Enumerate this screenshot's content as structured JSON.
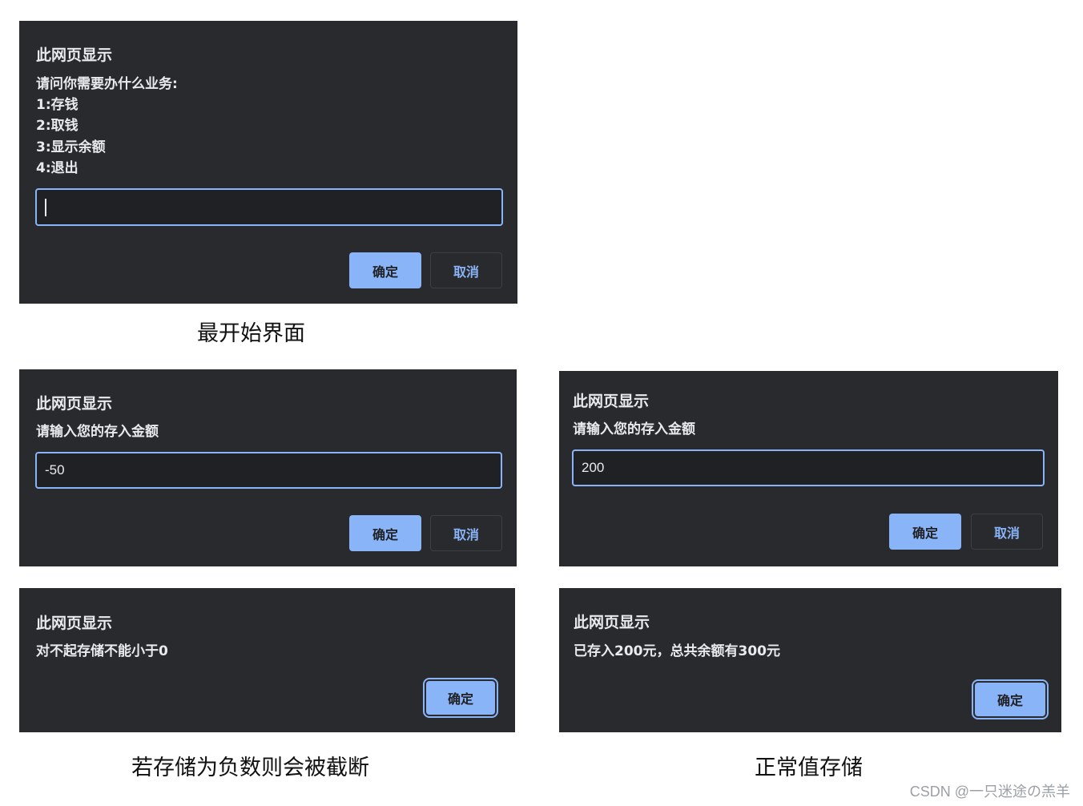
{
  "dialogs": {
    "menu": {
      "title": "此网页显示",
      "message": [
        "请问你需要办什么业务:",
        "1:存钱",
        "2:取钱",
        "3:显示余额",
        "4:退出"
      ],
      "input_value": "",
      "ok_label": "确定",
      "cancel_label": "取消"
    },
    "deposit_negative": {
      "title": "此网页显示",
      "message": "请输入您的存入金额",
      "input_value": "-50",
      "ok_label": "确定",
      "cancel_label": "取消"
    },
    "deposit_normal": {
      "title": "此网页显示",
      "message": "请输入您的存入金额",
      "input_value": "200",
      "ok_label": "确定",
      "cancel_label": "取消"
    },
    "alert_negative": {
      "title": "此网页显示",
      "message": "对不起存储不能小于0",
      "ok_label": "确定"
    },
    "alert_normal": {
      "title": "此网页显示",
      "message": "已存入200元，总共余额有300元",
      "ok_label": "确定"
    }
  },
  "captions": {
    "initial": "最开始界面",
    "negative": "若存储为负数则会被截断",
    "normal": "正常值存储"
  },
  "watermark": "CSDN @一只迷途の羔羊",
  "colors": {
    "dialog_bg": "#292a2d",
    "input_bg": "#202124",
    "accent": "#8ab4f8",
    "text": "#e8eaed"
  }
}
